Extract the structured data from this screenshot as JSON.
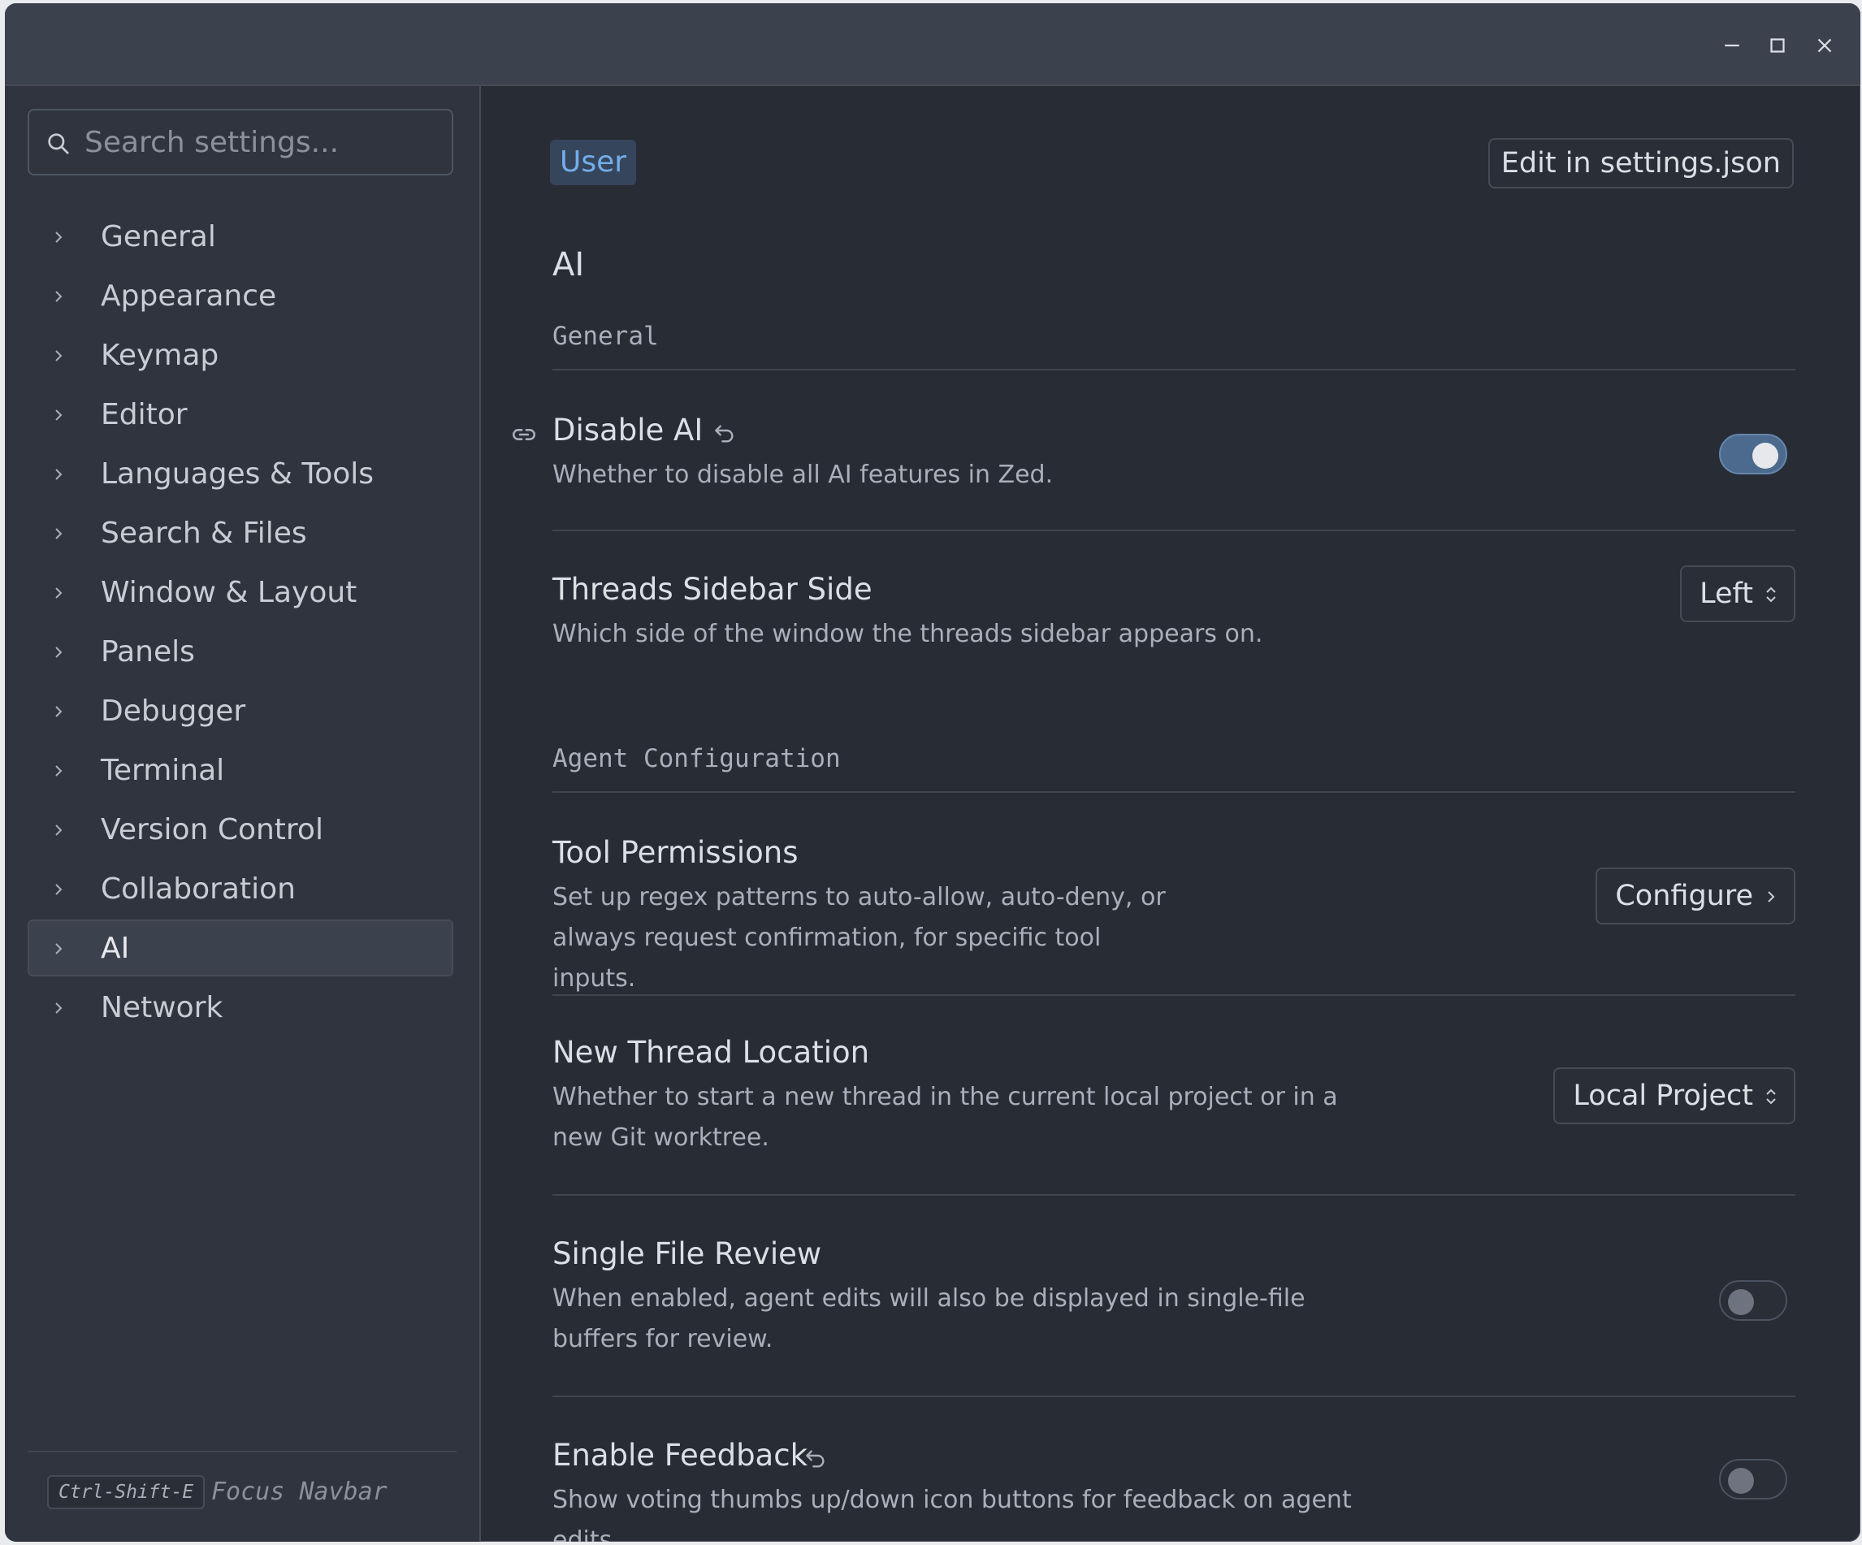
{
  "search": {
    "placeholder": "Search settings..."
  },
  "sidebar": {
    "items": [
      {
        "label": "General"
      },
      {
        "label": "Appearance"
      },
      {
        "label": "Keymap"
      },
      {
        "label": "Editor"
      },
      {
        "label": "Languages & Tools"
      },
      {
        "label": "Search & Files"
      },
      {
        "label": "Window & Layout"
      },
      {
        "label": "Panels"
      },
      {
        "label": "Debugger"
      },
      {
        "label": "Terminal"
      },
      {
        "label": "Version Control"
      },
      {
        "label": "Collaboration"
      },
      {
        "label": "AI",
        "active": true
      },
      {
        "label": "Network"
      }
    ],
    "footer": {
      "shortcut": "Ctrl-Shift-E",
      "hint": "Focus Navbar"
    }
  },
  "header": {
    "scope": "User",
    "edit_button": "Edit in settings.json"
  },
  "page": {
    "title": "AI",
    "sections": [
      {
        "heading": "General"
      },
      {
        "heading": "Agent Configuration"
      }
    ],
    "settings": {
      "disable_ai": {
        "title": "Disable AI",
        "desc": "Whether to disable all AI features in Zed.",
        "enabled": true
      },
      "threads_sidebar_side": {
        "title": "Threads Sidebar Side",
        "desc": "Which side of the window the threads sidebar appears on.",
        "value": "Left"
      },
      "tool_permissions": {
        "title": "Tool Permissions",
        "desc": "Set up regex patterns to auto-allow, auto-deny, or always request confirmation, for specific tool inputs.",
        "button": "Configure"
      },
      "new_thread_location": {
        "title": "New Thread Location",
        "desc": "Whether to start a new thread in the current local project or in a new Git worktree.",
        "value": "Local Project"
      },
      "single_file_review": {
        "title": "Single File Review",
        "desc": "When enabled, agent edits will also be displayed in single-file buffers for review.",
        "enabled": false
      },
      "enable_feedback": {
        "title": "Enable Feedback",
        "desc": "Show voting thumbs up/down icon buttons for feedback on agent edits.",
        "enabled": false
      }
    }
  },
  "colors": {
    "accent": "#74ade8",
    "toggle_on": "#4c6a8e",
    "background": "#282c34",
    "sidebar": "#2f343e"
  }
}
